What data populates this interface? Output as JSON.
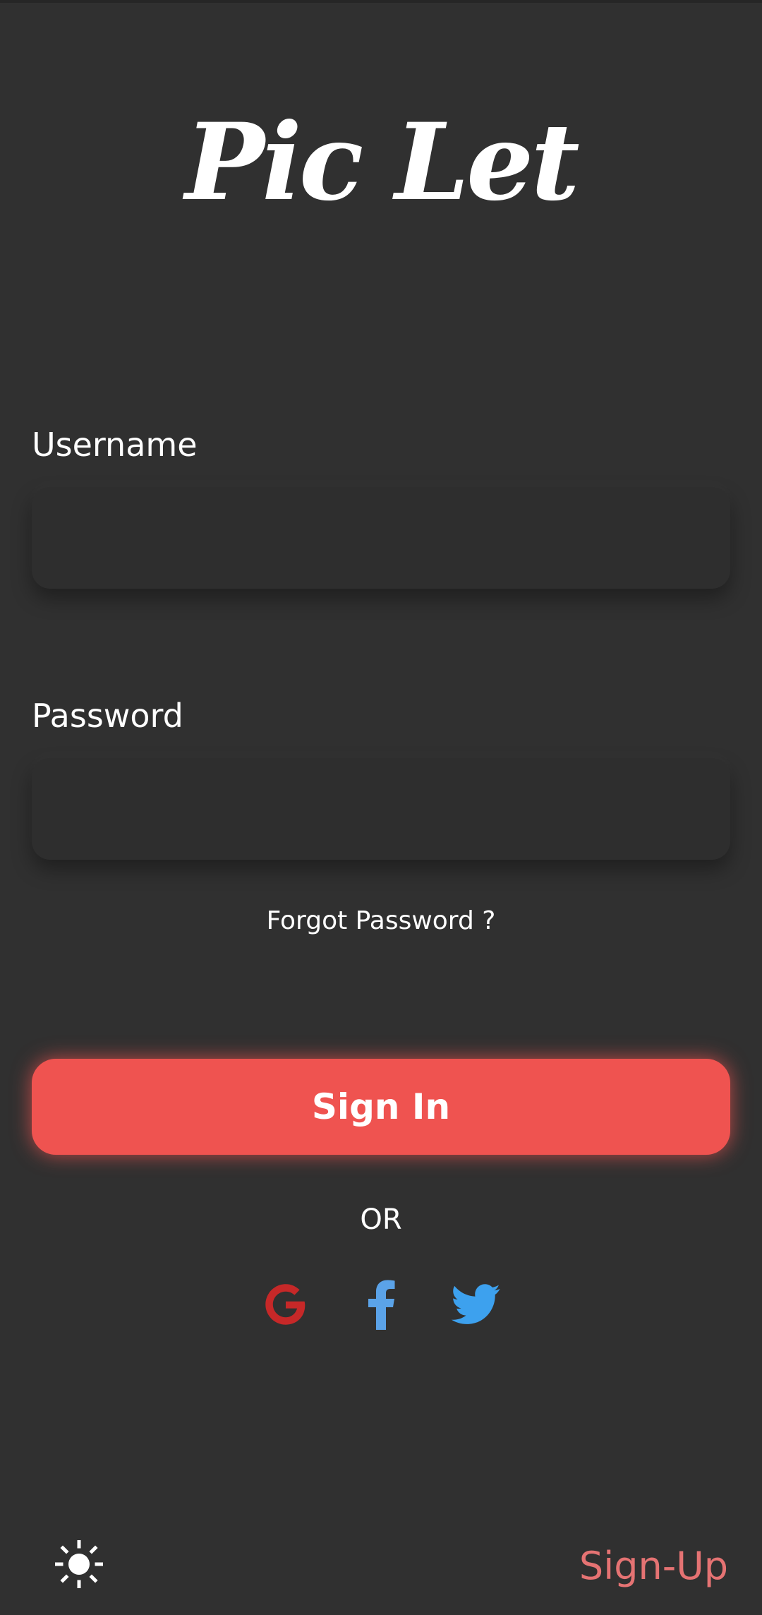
{
  "app": {
    "title": "Pic Let"
  },
  "form": {
    "username_label": "Username",
    "username_value": "",
    "password_label": "Password",
    "password_value": "",
    "forgot_label": "Forgot Password ?",
    "signin_label": "Sign In",
    "or_label": "OR"
  },
  "social": {
    "google_icon": "google-icon",
    "facebook_icon": "facebook-icon",
    "twitter_icon": "twitter-icon"
  },
  "footer": {
    "theme_icon": "sun-icon",
    "signup_label": "Sign-Up"
  },
  "colors": {
    "background": "#303030",
    "input_background": "#2e2e2e",
    "primary": "#ef5350",
    "signup": "#e57373",
    "google": "#c62828",
    "facebook": "#5ba3e8",
    "twitter": "#3da1ee"
  }
}
